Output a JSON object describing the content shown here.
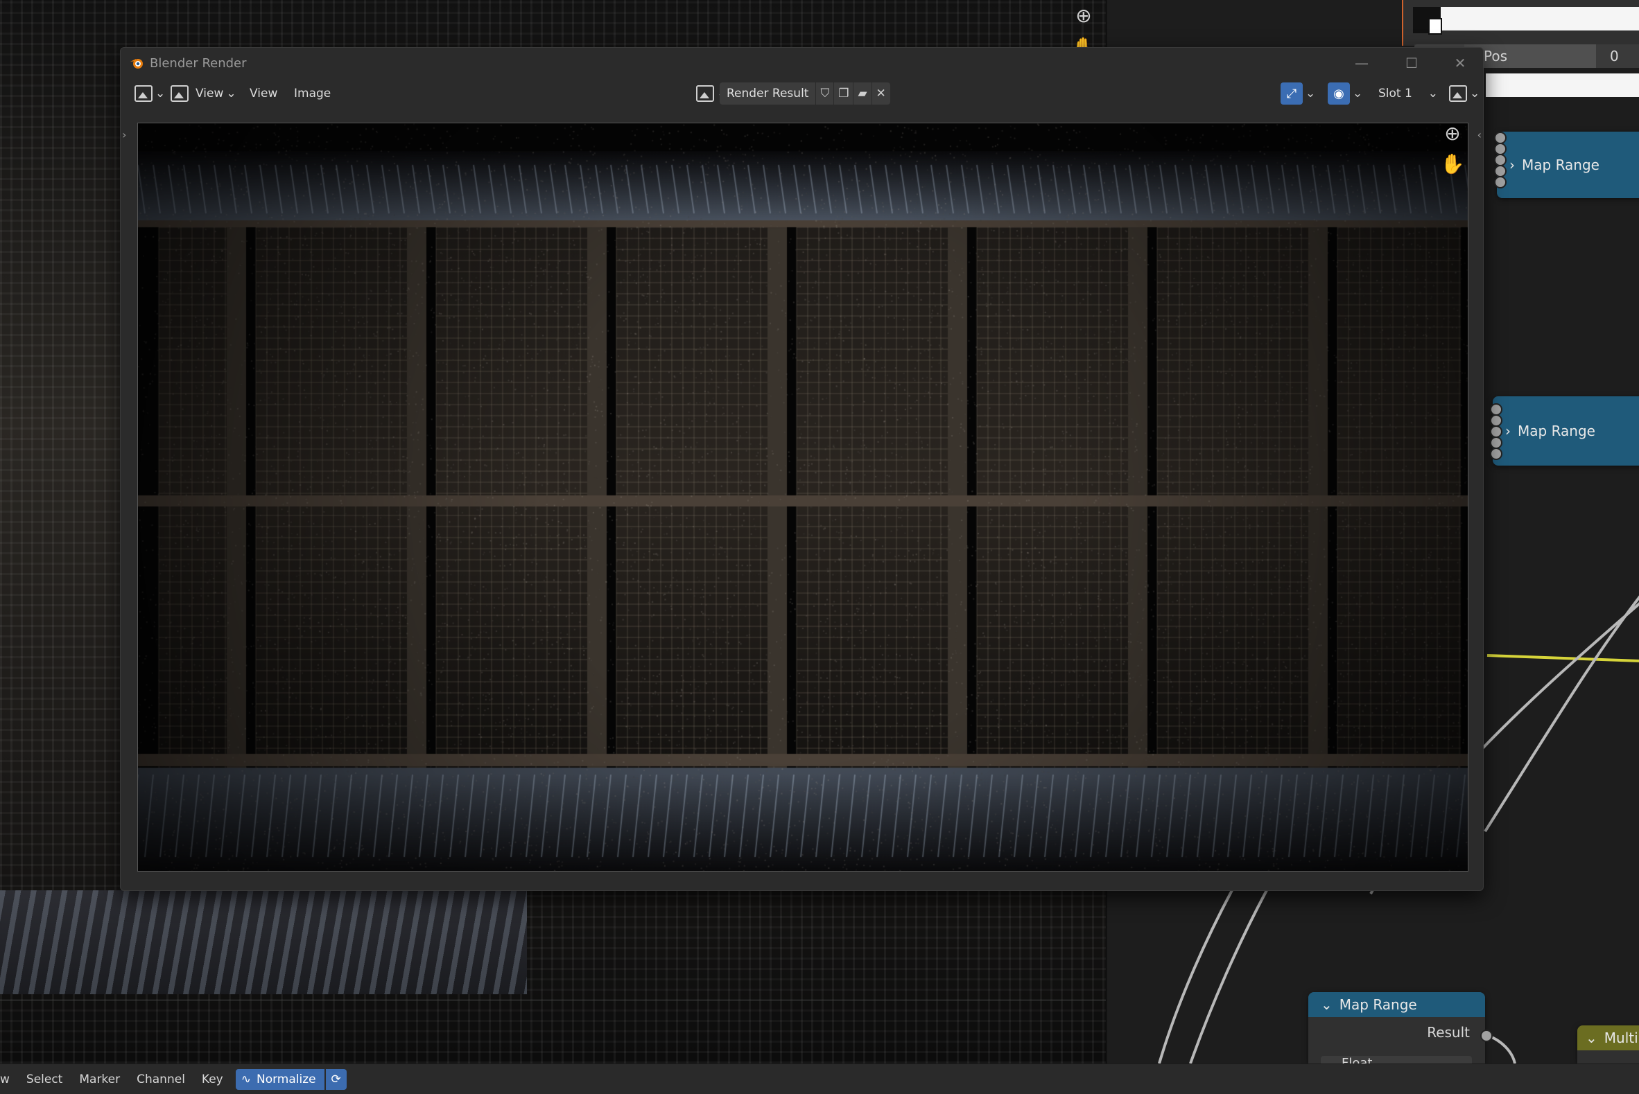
{
  "window": {
    "title": "Blender Render",
    "menus": [
      "View",
      "View",
      "Image"
    ],
    "image_name": "Render Result",
    "slot": "Slot 1"
  },
  "node_editor": {
    "pos_label": "Pos",
    "pos_suffix": "0",
    "nodes": [
      {
        "label": "Map Range",
        "expanded": false
      },
      {
        "label": "Map Range",
        "expanded": false
      },
      {
        "label": "Map Range",
        "expanded": true,
        "output": "Result",
        "field": "Float"
      },
      {
        "label": "Multi",
        "expanded": true
      }
    ]
  },
  "statusbar": {
    "items": [
      "w",
      "Select",
      "Marker",
      "Channel",
      "Key"
    ],
    "normalize_label": "Normalize"
  },
  "colors": {
    "accent_blue": "#3b6db3",
    "node_header_blue": "#1f5a7a",
    "node_header_olive": "#6b6d21",
    "link_yellow": "#d6d43a"
  },
  "icons": {
    "zoom": "magnify-plus-icon",
    "pan": "hand-icon",
    "blender_logo": "blender-logo-icon"
  }
}
